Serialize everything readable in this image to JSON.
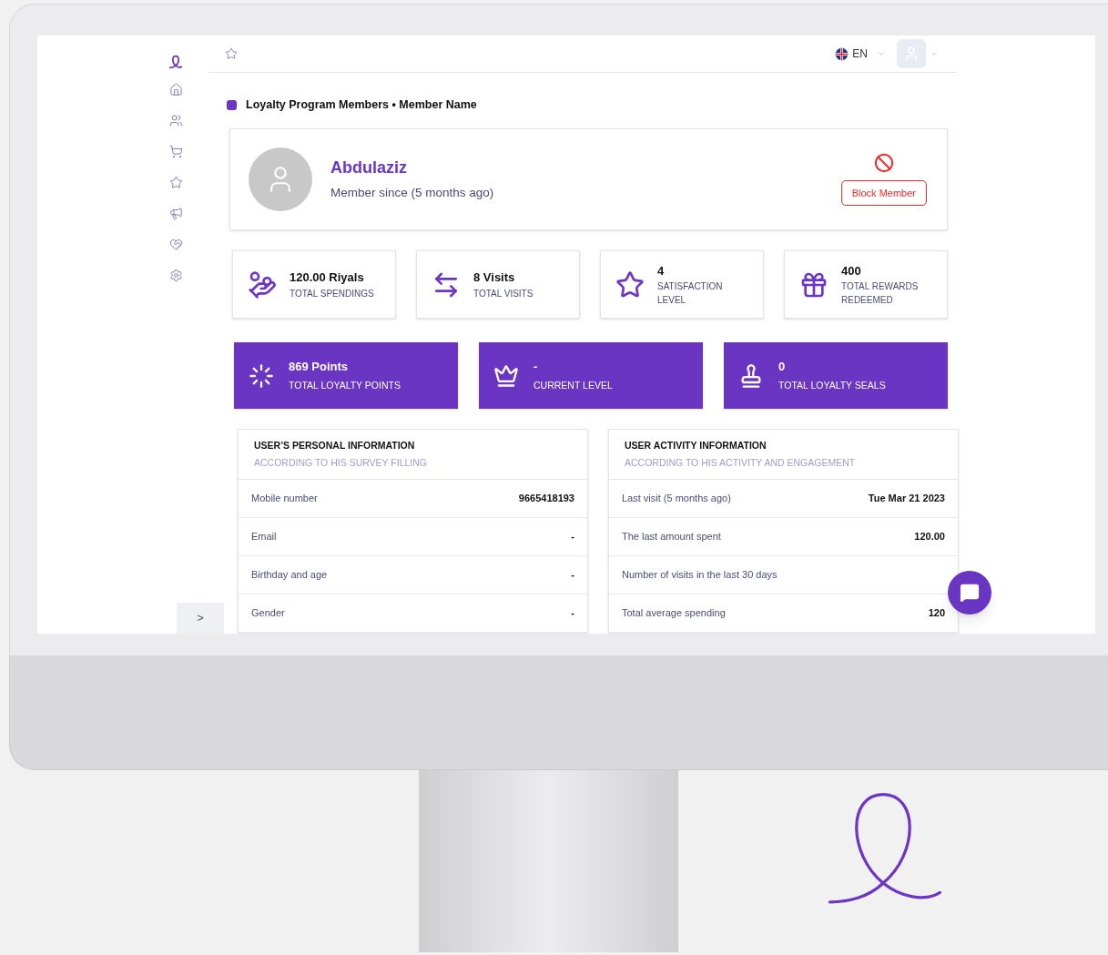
{
  "sidebar": {
    "toggle": ">"
  },
  "header": {
    "language": "EN"
  },
  "breadcrumb": "Loyalty Program Members • Member Name",
  "member": {
    "name": "Abdulaziz",
    "since": "Member since (5 months ago)",
    "block_button": "Block Member"
  },
  "stats": [
    {
      "value": "120.00 Riyals",
      "label": "TOTAL SPENDINGS"
    },
    {
      "value": "8 Visits",
      "label": "TOTAL VISITS"
    },
    {
      "value": "4",
      "label": "SATISFACTION LEVEL"
    },
    {
      "value": "400",
      "label": "TOTAL REWARDS REDEEMED"
    }
  ],
  "highlights": [
    {
      "value": "869 Points",
      "label": "TOTAL LOYALTY POINTS"
    },
    {
      "value": "-",
      "label": "CURRENT LEVEL"
    },
    {
      "value": "0",
      "label": "TOTAL LOYALTY SEALS"
    }
  ],
  "panels": [
    {
      "title": "USER’S PERSONAL INFORMATION",
      "subtitle": "ACCORDING TO HIS SURVEY FILLING",
      "rows": [
        {
          "label": "Mobile number",
          "value": "9665418193"
        },
        {
          "label": "Email",
          "value": "-"
        },
        {
          "label": "Birthday and age",
          "value": "-"
        },
        {
          "label": "Gender",
          "value": "-"
        }
      ]
    },
    {
      "title": "USER ACTIVITY INFORMATION",
      "subtitle": "ACCORDING TO HIS ACTIVITY AND ENGAGEMENT",
      "rows": [
        {
          "label": "Last visit (5 months ago)",
          "value": "Tue Mar 21 2023"
        },
        {
          "label": "The last amount spent",
          "value": "120.00"
        },
        {
          "label": "Number of visits in the last 30 days"
        },
        {
          "label": "Total average spending",
          "value": "120"
        }
      ]
    }
  ]
}
